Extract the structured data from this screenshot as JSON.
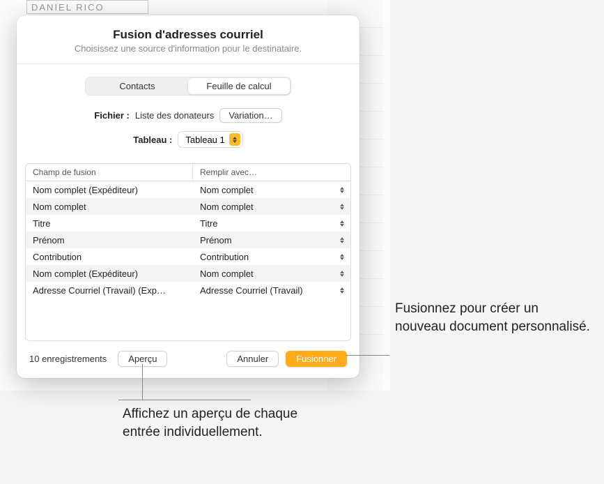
{
  "backdrop_fragment": "DANIEL RICO",
  "dialog": {
    "title": "Fusion d'adresses courriel",
    "subtitle": "Choisissez une source d'information pour le destinataire."
  },
  "segmented": {
    "contacts": "Contacts",
    "spreadsheet": "Feuille de calcul"
  },
  "file_row": {
    "label": "Fichier :",
    "value": "Liste des donateurs",
    "change_btn": "Variation…"
  },
  "table_row": {
    "label": "Tableau :",
    "value": "Tableau 1"
  },
  "columns": {
    "merge_field": "Champ de fusion",
    "fill_with": "Remplir avec…"
  },
  "rows": [
    {
      "field": "Nom complet (Expéditeur)",
      "fill": "Nom complet"
    },
    {
      "field": "Nom complet",
      "fill": "Nom complet"
    },
    {
      "field": "Titre",
      "fill": "Titre"
    },
    {
      "field": "Prénom",
      "fill": "Prénom"
    },
    {
      "field": "Contribution",
      "fill": "Contribution"
    },
    {
      "field": "Nom complet (Expéditeur)",
      "fill": "Nom complet"
    },
    {
      "field": "Adresse Courriel (Travail) (Exp…",
      "fill": "Adresse Courriel (Travail)"
    }
  ],
  "footer": {
    "count": "10 enregistrements",
    "preview": "Aperçu",
    "cancel": "Annuler",
    "merge": "Fusionner"
  },
  "callouts": {
    "right": "Fusionnez pour créer un nouveau document personnalisé.",
    "bottom": "Affichez un aperçu de chaque entrée individuellement."
  }
}
